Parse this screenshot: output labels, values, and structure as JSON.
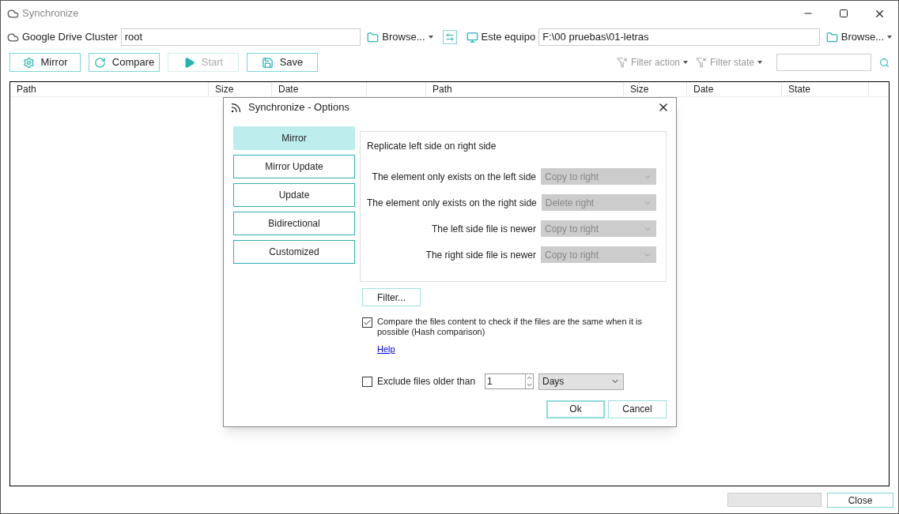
{
  "window": {
    "title": "Synchronize"
  },
  "source_bar": {
    "left": {
      "label": "Google Drive Cluster",
      "path": "root",
      "browse": "Browse..."
    },
    "right": {
      "label": "Este equipo",
      "path": "F:\\00 pruebas\\01-letras",
      "browse": "Browse..."
    }
  },
  "toolbar": {
    "buttons": [
      {
        "kind": "mirror",
        "label": "Mirror",
        "disabled": false
      },
      {
        "kind": "compare",
        "label": "Compare",
        "disabled": false
      },
      {
        "kind": "start",
        "label": "Start",
        "disabled": true
      },
      {
        "kind": "save",
        "label": "Save",
        "disabled": false
      }
    ],
    "filters": [
      {
        "label": "Filter action"
      },
      {
        "label": "Filter state"
      }
    ]
  },
  "table": {
    "left_columns": [
      "Path",
      "Size",
      "Date"
    ],
    "right_columns": [
      "Path",
      "Size",
      "Date",
      "State"
    ]
  },
  "footer": {
    "progress": {
      "level": 0
    },
    "close": "Close"
  },
  "dialog": {
    "title": "Synchronize - Options",
    "modes": [
      {
        "label": "Mirror",
        "selected": true
      },
      {
        "label": "Mirror Update",
        "selected": false
      },
      {
        "label": "Update",
        "selected": false
      },
      {
        "label": "Bidirectional",
        "selected": false
      },
      {
        "label": "Customized",
        "selected": false
      }
    ],
    "description": "Replicate left side on right side",
    "rules": [
      {
        "label": "The element only exists on the left side",
        "action": "Copy to right",
        "disabled": true
      },
      {
        "label": "The element only exists on the right side",
        "action": "Delete right",
        "disabled": true
      },
      {
        "label": "The left side file is newer",
        "action": "Copy to right",
        "disabled": true
      },
      {
        "label": "The right side file is newer",
        "action": "Copy to right",
        "disabled": true
      }
    ],
    "filter_button": "Filter...",
    "hash_compare": {
      "label": "Compare the files content to check if the files are the same when it is possible (Hash comparison)",
      "checked": true
    },
    "help_link": "Help",
    "exclude": {
      "label": "Exclude files older than",
      "checked": false,
      "value": "1",
      "unit": "Days"
    },
    "buttons": [
      {
        "label": "Ok",
        "default": true
      },
      {
        "label": "Cancel",
        "default": false
      }
    ]
  }
}
